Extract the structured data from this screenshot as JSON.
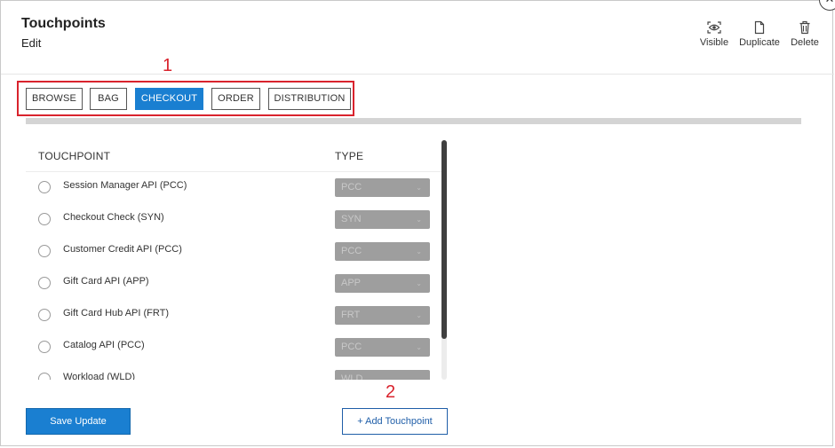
{
  "header": {
    "title": "Touchpoints",
    "subtitle": "Edit",
    "close_glyph": "✕"
  },
  "actions": {
    "visible_label": "Visible",
    "duplicate_label": "Duplicate",
    "delete_label": "Delete"
  },
  "annotations": {
    "marker_1": "1",
    "marker_2": "2",
    "highlight_color": "#d9232d"
  },
  "tabs": [
    {
      "label": "BROWSE",
      "active": false
    },
    {
      "label": "BAG",
      "active": false
    },
    {
      "label": "CHECKOUT",
      "active": true
    },
    {
      "label": "ORDER",
      "active": false
    },
    {
      "label": "DISTRIBUTION",
      "active": false
    }
  ],
  "table": {
    "columns": {
      "touchpoint": "TOUCHPOINT",
      "type": "TYPE"
    },
    "rows": [
      {
        "name": "Session Manager API (PCC)",
        "type": "PCC"
      },
      {
        "name": "Checkout Check (SYN)",
        "type": "SYN"
      },
      {
        "name": "Customer Credit API (PCC)",
        "type": "PCC"
      },
      {
        "name": "Gift Card API (APP)",
        "type": "APP"
      },
      {
        "name": "Gift Card Hub API (FRT)",
        "type": "FRT"
      },
      {
        "name": "Catalog API (PCC)",
        "type": "PCC"
      },
      {
        "name": "Workload (WLD)",
        "type": "WLD"
      }
    ]
  },
  "footer": {
    "save_label": "Save Update",
    "add_label": "+ Add Touchpoint"
  },
  "colors": {
    "accent": "#1a7fd1",
    "select_disabled": "#9e9e9e"
  }
}
